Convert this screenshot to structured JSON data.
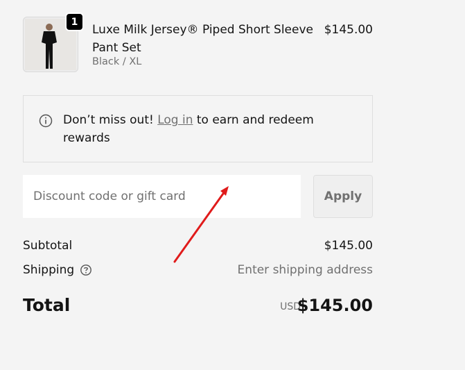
{
  "product": {
    "quantity": "1",
    "title": "Luxe Milk Jersey® Piped Short Sleeve Pant Set",
    "variant": "Black / XL",
    "price": "$145.00",
    "image_icon": "product-thumbnail"
  },
  "notice": {
    "icon": "info-icon",
    "prefix": "Don’t miss out!",
    "link": "Log in",
    "suffix": "to earn and redeem rewards"
  },
  "discount": {
    "placeholder": "Discount code or gift card",
    "value": "",
    "apply_label": "Apply"
  },
  "summary": {
    "subtotal_label": "Subtotal",
    "subtotal_value": "$145.00",
    "shipping_label": "Shipping",
    "shipping_value": "Enter shipping address",
    "total_label": "Total",
    "currency": "USD",
    "total_value": "$145.00"
  },
  "annotation": {
    "color": "#e01b1b"
  }
}
